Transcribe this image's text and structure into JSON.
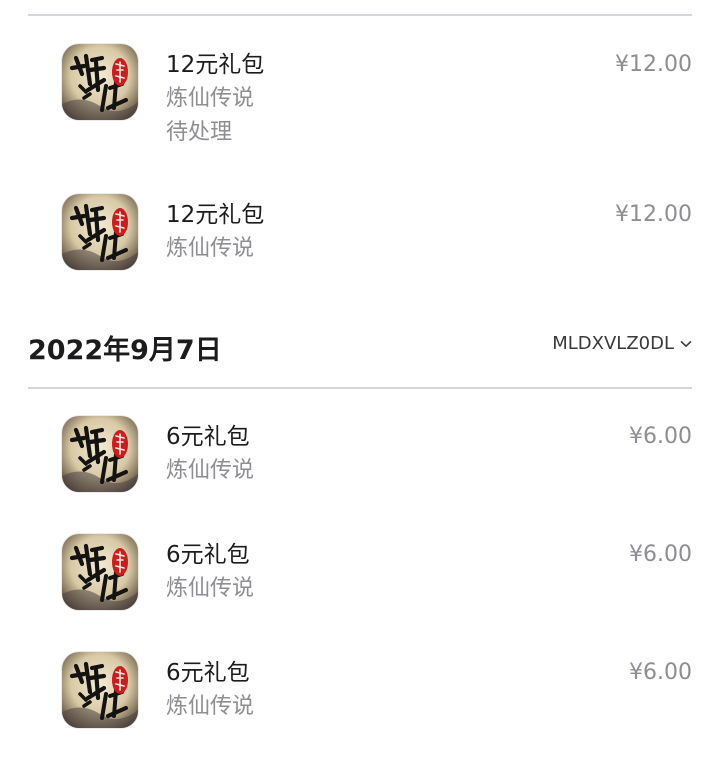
{
  "section_top": {
    "items": [
      {
        "title": "12元礼包",
        "app_name": "炼仙传说",
        "status": "待处理",
        "price": "¥12.00"
      },
      {
        "title": "12元礼包",
        "app_name": "炼仙传说",
        "price": "¥12.00"
      }
    ]
  },
  "section_sep7": {
    "date": "2022年9月7日",
    "order_id": "MLDXVLZ0DL",
    "items": [
      {
        "title": "6元礼包",
        "app_name": "炼仙传说",
        "price": "¥6.00"
      },
      {
        "title": "6元礼包",
        "app_name": "炼仙传说",
        "price": "¥6.00"
      },
      {
        "title": "6元礼包",
        "app_name": "炼仙传说",
        "price": "¥6.00"
      }
    ]
  },
  "icons": {
    "app_icon": "game-app-icon",
    "expand": "chevron-down-icon"
  },
  "colors": {
    "primary_text": "#1c1c1e",
    "secondary_text": "#8e8e93",
    "divider": "#d6d6da",
    "icon_red_seal": "#c81e1e"
  }
}
